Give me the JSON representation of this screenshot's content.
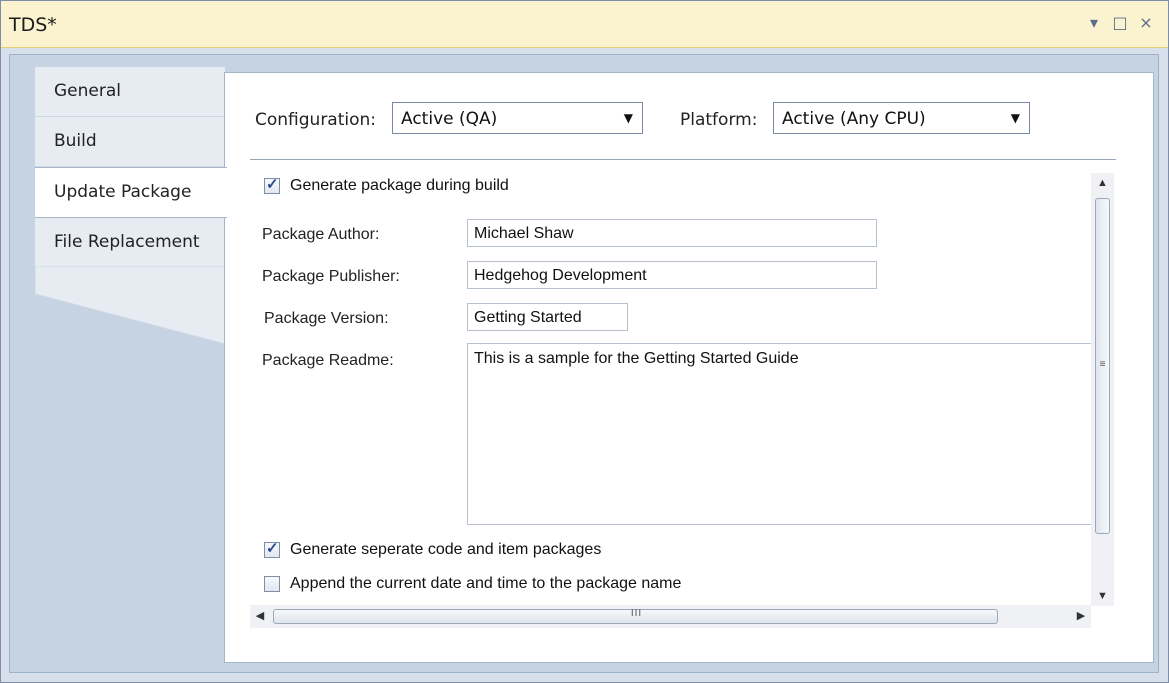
{
  "window": {
    "title": "TDS*",
    "dropdown_icon": "▾",
    "maximize_icon": "□",
    "close_icon": "×"
  },
  "tabs": [
    {
      "label": "General"
    },
    {
      "label": "Build"
    },
    {
      "label": "Update Package",
      "active": true
    },
    {
      "label": "File Replacement"
    }
  ],
  "config": {
    "configuration_label": "Configuration:",
    "configuration_value": "Active (QA)",
    "platform_label": "Platform:",
    "platform_value": "Active (Any CPU)"
  },
  "form": {
    "generate_package_label": "Generate package during build",
    "generate_package_checked": true,
    "author_label": "Package Author:",
    "author_value": "Michael Shaw",
    "publisher_label": "Package Publisher:",
    "publisher_value": "Hedgehog Development",
    "version_label": "Package Version:",
    "version_value": "Getting Started",
    "readme_label": "Package Readme:",
    "readme_value": "This is a sample for the Getting Started Guide",
    "separate_packages_label": "Generate seperate code and item packages",
    "separate_packages_checked": true,
    "append_date_label": "Append the current date and time to the package name",
    "append_date_checked": false
  },
  "scrollbars": {
    "up_arrow": "▲",
    "down_arrow": "▼",
    "left_arrow": "◀",
    "right_arrow": "▶",
    "v_grip": "≡",
    "h_grip": "III"
  },
  "colors": {
    "titlebar": "#fbf3cf",
    "frame": "#c6d3e3",
    "active_tab": "#ffffff"
  }
}
